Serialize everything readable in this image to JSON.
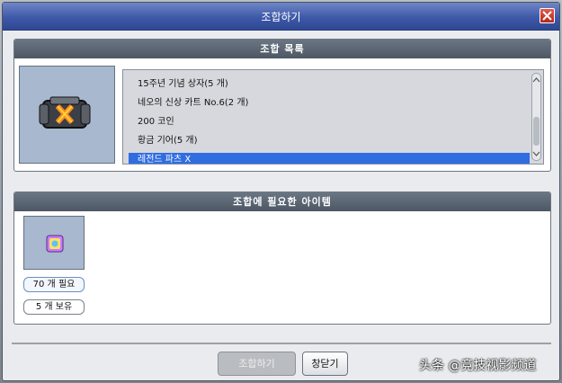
{
  "window": {
    "title": "조합하기"
  },
  "recipe_panel": {
    "header": "조합 목록",
    "items": [
      {
        "label": "15주년 기념 상자(5 개)"
      },
      {
        "label": "네오의 신상 카트 No.6(2 개)"
      },
      {
        "label": "200 코인"
      },
      {
        "label": "황금 기어(5 개)"
      },
      {
        "label": "레전드 파츠 X"
      }
    ],
    "selected_index": 4,
    "preview_icon": "legend-parts-x-icon"
  },
  "required_panel": {
    "header": "조합에 필요한 아이템",
    "item_icon": "material-item-icon",
    "needed": "70 개 필요",
    "owned": "5 개 보유"
  },
  "buttons": {
    "combine": "조합하기",
    "close": "창닫기"
  },
  "watermark": "头条 @竞技视影频道",
  "colors": {
    "titlebar": "#3e59a8",
    "selection": "#2f6de1",
    "slot_bg": "#a7b8cf"
  }
}
